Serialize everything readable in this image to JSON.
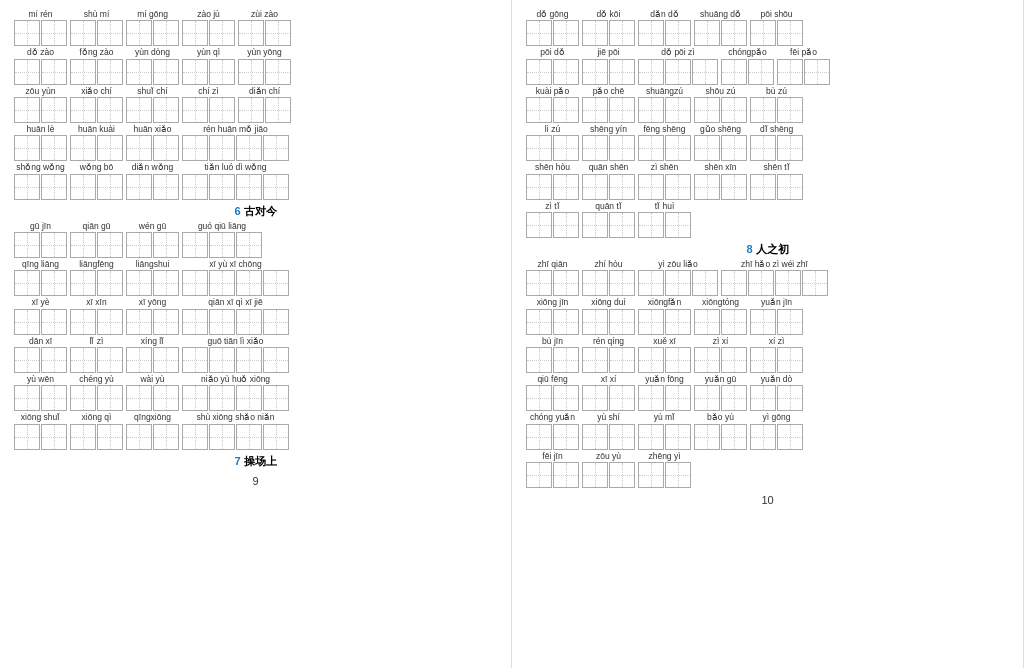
{
  "page9": {
    "number": "9",
    "rows": [
      [
        "mí rén",
        "shù mí",
        "mí gōng",
        "zào jù",
        "zùi zào"
      ],
      [
        "dǒ zào",
        "fǒng zào",
        "yùn dòng",
        "yùn qì",
        "yùn yōng"
      ],
      [
        "zōu yùn",
        "xiǎo chí",
        "shuǐ chí",
        "chí zì",
        "diǎn chí"
      ],
      [
        "huān lè",
        "huān kuài",
        "huān xiǎo",
        "rén huān mǒ jiāo"
      ],
      [
        "shǒng wǒng",
        "wǒng bō",
        "diǎn wǒng",
        "tiǎn luó dì wǒng"
      ],
      [],
      [
        "gū jīn",
        "qiān gū",
        "wén gū",
        "guó qiū liāng"
      ],
      [
        "qīng liāng",
        "liāngfēng",
        "liāngshui",
        "xī yù xī chōng"
      ],
      [
        "xī yè",
        "xī xīn",
        "xī yōng",
        "qiān xī qì xī jiē"
      ],
      [
        "dān xī",
        "lǐ zì",
        "xíng lǐ",
        "guō tiān lì xiǎo"
      ],
      [
        "yù wēn",
        "chéng yù",
        "wài yù",
        "niǎo yù huǒ xiōng"
      ],
      [
        "xiōng shuǐ",
        "xiōng qì",
        "qīngxiōng",
        "shù xiōng shǎo niǎn"
      ]
    ],
    "section6": "6 古对今",
    "section7": "7 操场上"
  },
  "page10": {
    "number": "10",
    "rows": [
      [
        "dǒ gōng dǒ kōi dǎn dǒ shuāng dǒ pōi shōu"
      ],
      [
        "pōi dǒ jiē pōi dǒ pōi zì chóngpǎo fēi pǎo"
      ],
      [
        "kuài pǎo pǎo chē shuāngzú shōu zú bù zú"
      ],
      [
        "lì zú shēng yín fēng shēng gǔo shēng dǐ shēng"
      ],
      [
        "shēn hòu quān shēn zì shēn shēn xīn shēn tǐ"
      ],
      [
        "zì tǐ quān tǐ tǐ huì"
      ],
      [],
      [
        "zhī qiān zhí hòu yì zōu liǎo zhī hǎo zì wéi zhī"
      ],
      [
        "xiōng jīn xiōng duì xiōngfǎn xiōngtóng yuǎn jīn"
      ],
      [
        "bù jīn rén qíng xuě xī zì xí xí zì"
      ],
      [
        "qiū fēng xī xí yuǎn fōng yuǎn gū yuǎn dò"
      ],
      [
        "chóng yuǎn yù shí yù mǐ bǎo yù yì gōng"
      ],
      [
        "fēi jīn zōu yù zhēng yì"
      ]
    ],
    "section8": "8 人之初"
  }
}
